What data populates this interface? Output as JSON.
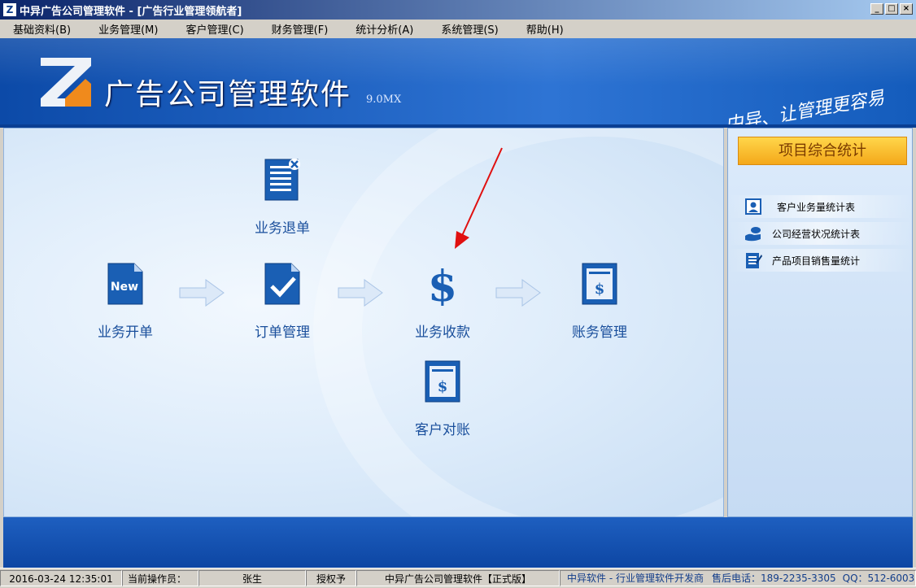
{
  "window": {
    "title": "中异广告公司管理软件 - [广告行业管理领航者]",
    "app_icon": "Z",
    "controls": [
      "_",
      "□",
      "×"
    ]
  },
  "menu": [
    "基础资料(B)",
    "业务管理(M)",
    "客户管理(C)",
    "财务管理(F)",
    "统计分析(A)",
    "系统管理(S)",
    "帮助(H)"
  ],
  "banner": {
    "title": "广告公司管理软件",
    "version": "9.0MX",
    "slogan": "中异、让管理更容易"
  },
  "workflow": {
    "new_order": "业务开单",
    "order_manage": "订单管理",
    "payment": "业务收款",
    "accounts": "账务管理",
    "refund": "业务退单",
    "reconcile": "客户对账",
    "new_icon_text": "New"
  },
  "panel": {
    "header": "项目综合统计",
    "items": [
      "客户业务量统计表",
      "公司经营状况统计表",
      "产品项目销售量统计"
    ]
  },
  "status": {
    "datetime": "2016-03-24 12:35:01",
    "operator_label": "当前操作员：",
    "operator": "张生",
    "auth": "授权予",
    "edition": "中异广告公司管理软件【正式版】",
    "vendor": "中异软件 - 行业管理软件开发商",
    "hotline_label": "售后电话：",
    "hotline": "189-2235-3305",
    "qq_label": "QQ：",
    "qq": "512-6003"
  },
  "colors": {
    "accent": "#1a4f9c",
    "banner": "#1c5fc0",
    "panel_button": "#f8b82a"
  }
}
